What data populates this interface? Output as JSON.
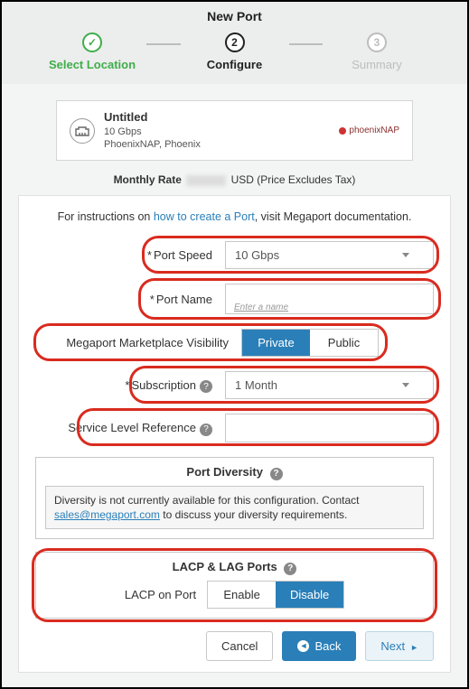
{
  "page_title": "New Port",
  "steps": {
    "s1": {
      "label": "Select Location"
    },
    "s2": {
      "num": "2",
      "label": "Configure"
    },
    "s3": {
      "num": "3",
      "label": "Summary"
    }
  },
  "summary_card": {
    "title": "Untitled",
    "speed": "10 Gbps",
    "location": "PhoenixNAP, Phoenix",
    "partner": "phoenixNAP"
  },
  "rate": {
    "label": "Monthly Rate",
    "currency_suffix": "USD (Price Excludes Tax)"
  },
  "instructions": {
    "pre": "For instructions on ",
    "link_text": "how to create a Port",
    "post": ", visit Megaport documentation."
  },
  "fields": {
    "port_speed": {
      "label": "Port Speed",
      "value": "10 Gbps"
    },
    "port_name": {
      "label": "Port Name",
      "placeholder": "Enter a name",
      "value": ""
    },
    "visibility": {
      "label": "Megaport Marketplace Visibility",
      "options": {
        "private": "Private",
        "public": "Public"
      },
      "active": "private"
    },
    "subscription": {
      "label": "Subscription",
      "value": "1 Month"
    },
    "slr": {
      "label": "Service Level Reference",
      "value": ""
    }
  },
  "diversity": {
    "title": "Port Diversity",
    "msg_pre": "Diversity is not currently available for this configuration. Contact ",
    "email": "sales@megaport.com",
    "msg_post": " to discuss your diversity requirements."
  },
  "lacp": {
    "title": "LACP & LAG Ports",
    "row_label": "LACP on Port",
    "options": {
      "enable": "Enable",
      "disable": "Disable"
    },
    "active": "disable"
  },
  "buttons": {
    "cancel": "Cancel",
    "back": "Back",
    "next": "Next"
  }
}
